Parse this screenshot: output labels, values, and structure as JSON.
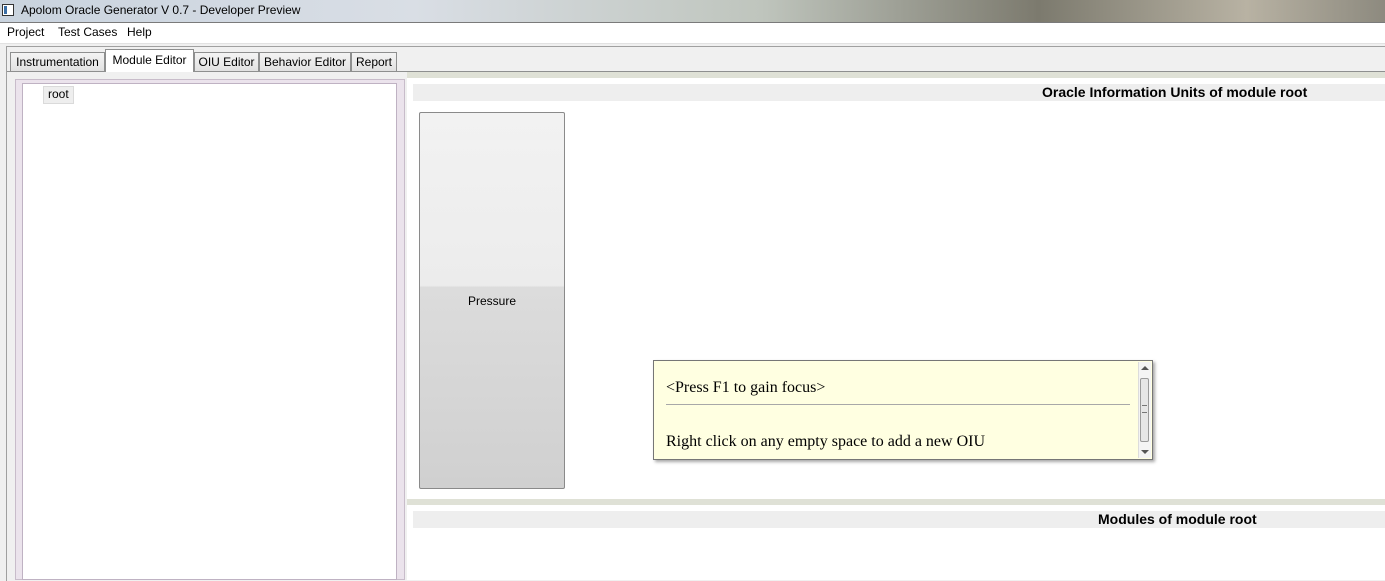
{
  "window": {
    "title": "Apolom Oracle Generator V 0.7 - Developer Preview"
  },
  "menu": {
    "items": [
      "Project",
      "Test Cases",
      "Help"
    ]
  },
  "tabs": [
    "Instrumentation",
    "Module Editor",
    "OIU Editor",
    "Behavior Editor",
    "Report"
  ],
  "active_tab": "Module Editor",
  "tree": {
    "root_label": "root"
  },
  "oiu_panel": {
    "header": "Oracle Information Units of module root",
    "units": [
      {
        "label": "Pressure"
      }
    ]
  },
  "tooltip": {
    "focus_hint": "<Press F1 to gain focus>",
    "message": "Right click on any empty space to add a new OIU"
  },
  "modules_panel": {
    "header": "Modules of module root"
  }
}
